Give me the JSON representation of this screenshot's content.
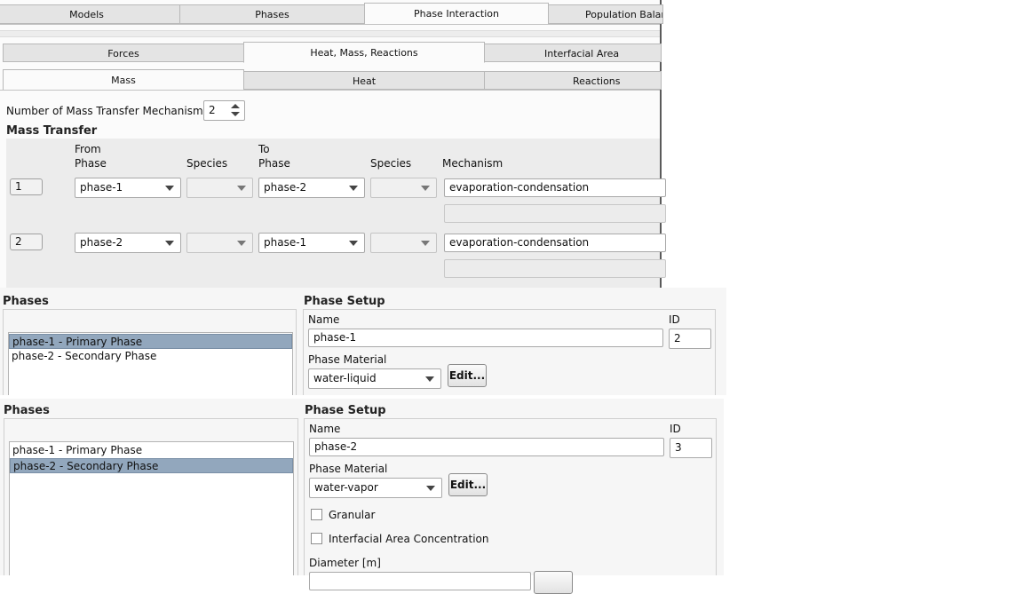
{
  "top_tabs": [
    "Models",
    "Phases",
    "Phase Interaction",
    "Population Balance"
  ],
  "sub_tabs": [
    "Forces",
    "Heat, Mass, Reactions",
    "Interfacial Area"
  ],
  "sub_sub_tabs": [
    "Mass",
    "Heat",
    "Reactions"
  ],
  "mass": {
    "mechanisms_label": "Number of Mass Transfer Mechanisms",
    "mechanisms_value": "2",
    "section_title": "Mass Transfer",
    "headers": {
      "from_line1": "From",
      "from_line2": "Phase",
      "species": "Species",
      "to_line1": "To",
      "to_line2": "Phase",
      "species2": "Species",
      "mechanism": "Mechanism"
    },
    "rows": [
      {
        "num": "1",
        "from": "phase-1",
        "from_species": "",
        "to": "phase-2",
        "to_species": "",
        "mechanism": "evaporation-condensation"
      },
      {
        "num": "2",
        "from": "phase-2",
        "from_species": "",
        "to": "phase-1",
        "to_species": "",
        "mechanism": "evaporation-condensation"
      }
    ]
  },
  "panel1": {
    "phases_title": "Phases",
    "phases_list": [
      "phase-1 - Primary Phase",
      "phase-2 - Secondary Phase"
    ],
    "selected_index": 0,
    "setup_title": "Phase Setup",
    "name_label": "Name",
    "name_value": "phase-1",
    "id_label": "ID",
    "id_value": "2",
    "material_label": "Phase Material",
    "material_value": "water-liquid",
    "edit_label": "Edit..."
  },
  "panel2": {
    "phases_title": "Phases",
    "phases_list": [
      "phase-1 - Primary Phase",
      "phase-2 - Secondary Phase"
    ],
    "selected_index": 1,
    "setup_title": "Phase Setup",
    "name_label": "Name",
    "name_value": "phase-2",
    "id_label": "ID",
    "id_value": "3",
    "material_label": "Phase Material",
    "material_value": "water-vapor",
    "edit_label": "Edit...",
    "granular_label": "Granular",
    "granular_checked": false,
    "iac_label": "Interfacial Area Concentration",
    "iac_checked": false,
    "diameter_label": "Diameter [m]"
  }
}
